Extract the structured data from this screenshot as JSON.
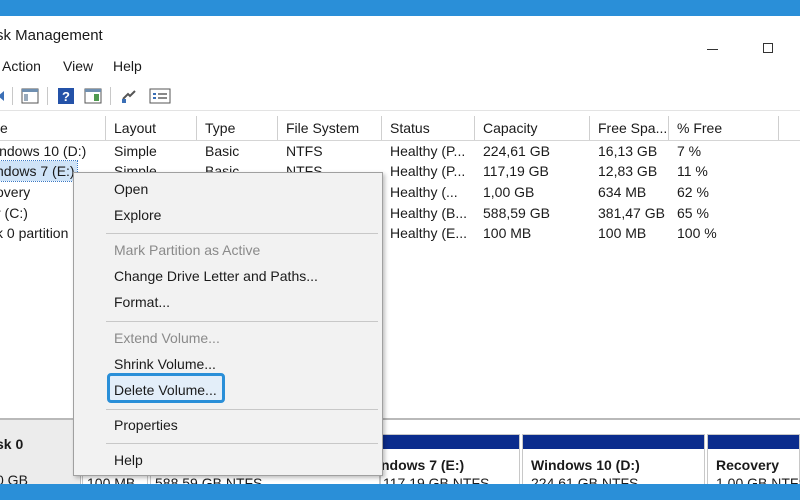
{
  "window": {
    "title": "sk Management"
  },
  "menu": [
    "Action",
    "View",
    "Help"
  ],
  "toolbar": {
    "icons": [
      "back-icon",
      "console-tree-icon",
      "help-icon",
      "action-pane-icon",
      "connect-icon",
      "properties-icon"
    ]
  },
  "columns": [
    "e",
    "Layout",
    "Type",
    "File System",
    "Status",
    "Capacity",
    "Free Spa...",
    "% Free"
  ],
  "volumes": [
    {
      "name": "indows 10 (D:)",
      "layout": "Simple",
      "type": "Basic",
      "fs": "NTFS",
      "status": "Healthy (P...",
      "capacity": "224,61 GB",
      "free": "16,13 GB",
      "pct": "7 %"
    },
    {
      "name": "ndows 7 (E:)",
      "layout": "Simple",
      "type": "Basic",
      "fs": "NTFS",
      "status": "Healthy (P...",
      "capacity": "117,19 GB",
      "free": "12,83 GB",
      "pct": "11 %"
    },
    {
      "name": "overy",
      "layout": "",
      "type": "",
      "fs": "",
      "status": "Healthy (...",
      "capacity": "1,00 GB",
      "free": "634 MB",
      "pct": "62 %"
    },
    {
      "name": "r (C:)",
      "layout": "",
      "type": "",
      "fs": "",
      "status": "Healthy (B...",
      "capacity": "588,59 GB",
      "free": "381,47 GB",
      "pct": "65 %"
    },
    {
      "name": "k 0 partition",
      "layout": "",
      "type": "",
      "fs": "",
      "status": "Healthy (E...",
      "capacity": "100 MB",
      "free": "100 MB",
      "pct": "100 %"
    }
  ],
  "context_menu": {
    "items": [
      {
        "label": "Open",
        "enabled": true
      },
      {
        "label": "Explore",
        "enabled": true
      },
      {
        "label": "Mark Partition as Active",
        "enabled": false
      },
      {
        "label": "Change Drive Letter and Paths...",
        "enabled": true
      },
      {
        "label": "Format...",
        "enabled": true
      },
      {
        "label": "Extend Volume...",
        "enabled": false
      },
      {
        "label": "Shrink Volume...",
        "enabled": true
      },
      {
        "label": "Delete Volume...",
        "enabled": true,
        "highlighted": true
      },
      {
        "label": "Properties",
        "enabled": true
      },
      {
        "label": "Help",
        "enabled": true
      }
    ]
  },
  "disk": {
    "name": "sk 0",
    "size": "0 GB",
    "partitions": [
      {
        "name": "",
        "size": "100 MB"
      },
      {
        "name": "",
        "size": "588,59 GB NTFS"
      },
      {
        "name": "ndows 7 (E:)",
        "size": "117,19 GB NTFS"
      },
      {
        "name": "Windows 10 (D:)",
        "size": "224,61 GB NTFS"
      },
      {
        "name": "Recovery",
        "size": "1,00 GB NTFS"
      }
    ]
  },
  "colors": {
    "frame": "#2a8fd8",
    "partition_bar": "#0b2c8d",
    "highlight_border": "#2a8fd8",
    "selection": "#cfe3f7"
  }
}
